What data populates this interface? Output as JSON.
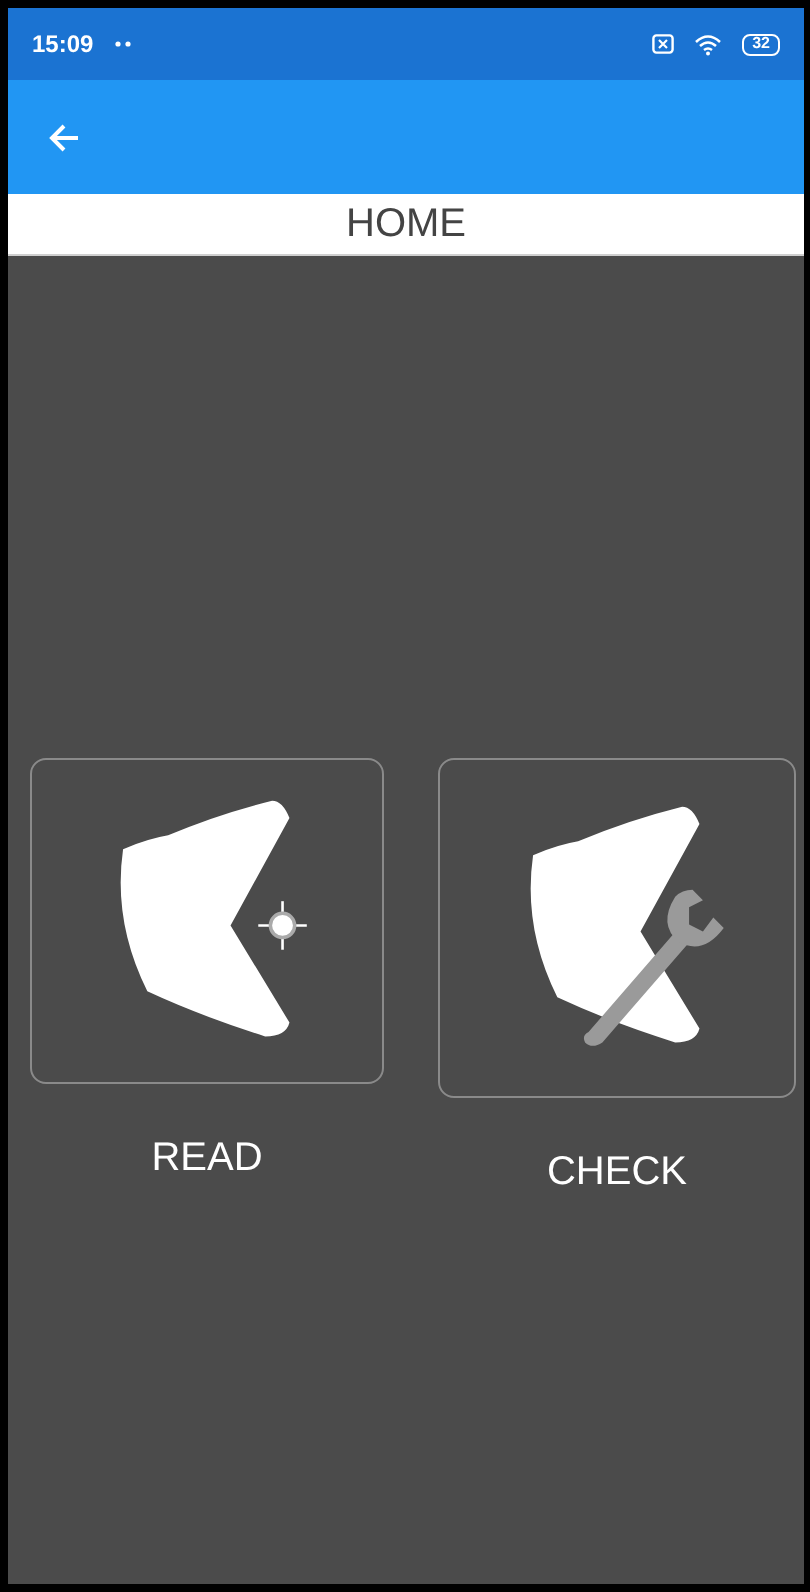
{
  "status_bar": {
    "time": "15:09",
    "battery": "32"
  },
  "header": {
    "title": "HOME"
  },
  "tiles": [
    {
      "kind": "read",
      "label": "READ"
    },
    {
      "kind": "check",
      "label": "CHECK"
    }
  ]
}
